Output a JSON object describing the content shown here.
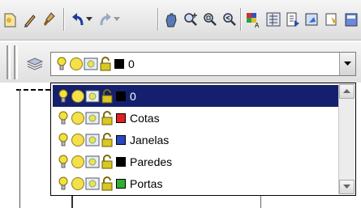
{
  "toolbar": {
    "icons": [
      "open-file-icon",
      "pencil-icon",
      "brush-icon",
      "undo-icon",
      "undo-dropdown-icon",
      "redo-icon",
      "redo-dropdown-icon",
      "pan-icon",
      "zoom-realtime-icon",
      "zoom-window-icon",
      "zoom-previous-icon",
      "properties-icon",
      "design-center-icon",
      "tool-palette-icon",
      "sheet-set-icon"
    ]
  },
  "layer_toolbar": {
    "layer_manager_icon": "layer-stack-icon",
    "current_layer": {
      "name": "0",
      "color": "#000000"
    }
  },
  "layer_dropdown": {
    "items": [
      {
        "name": "0",
        "color": "#000000",
        "selected": true
      },
      {
        "name": "Cotas",
        "color": "#e02020",
        "selected": false
      },
      {
        "name": "Janelas",
        "color": "#2848c0",
        "selected": false
      },
      {
        "name": "Paredes",
        "color": "#000000",
        "selected": false
      },
      {
        "name": "Portas",
        "color": "#30b030",
        "selected": false
      }
    ]
  },
  "colors": {
    "selection": "#14206e",
    "bulb": "#f2e23a",
    "sun": "#f3e04a",
    "lock": "#d8c820"
  }
}
